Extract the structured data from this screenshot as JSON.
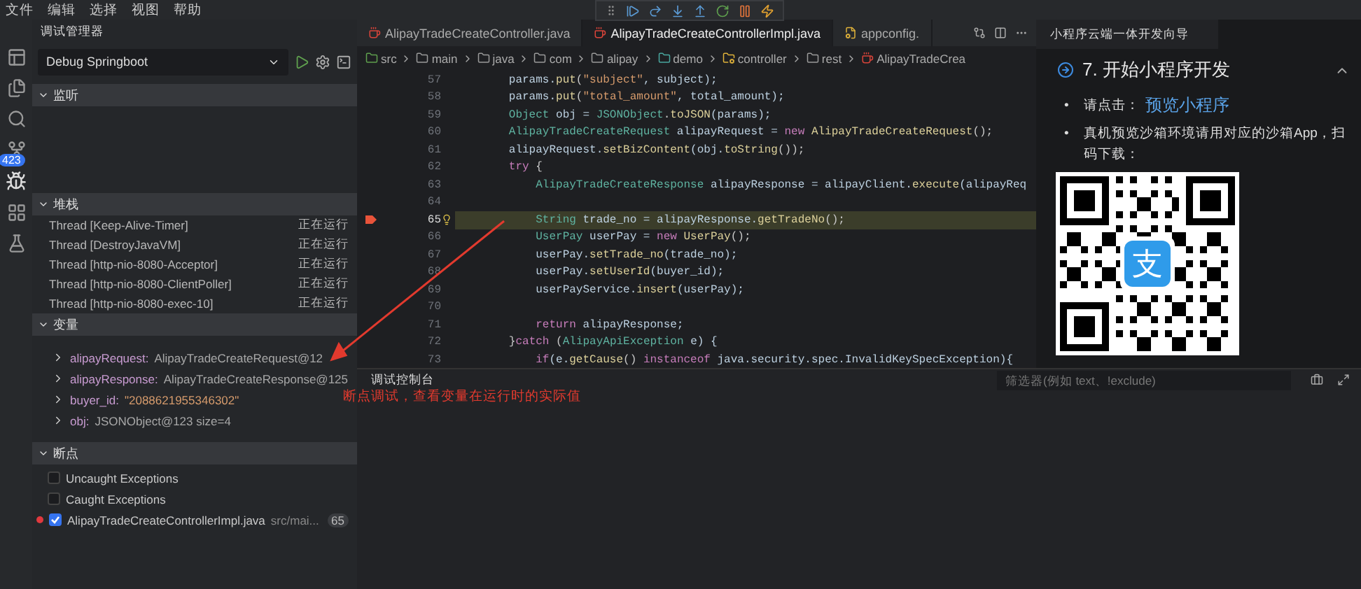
{
  "menu": [
    "文件",
    "编辑",
    "选择",
    "视图",
    "帮助"
  ],
  "activity_bar": {
    "source_control_badge": "423"
  },
  "sidebar": {
    "title": "调试管理器",
    "config": "Debug Springboot",
    "sections": [
      {
        "title": "监听",
        "kind": "watch",
        "expanded": true
      },
      {
        "title": "堆栈",
        "kind": "stack",
        "expanded": true
      },
      {
        "title": "变量",
        "kind": "variables",
        "expanded": true
      },
      {
        "title": "断点",
        "kind": "breakpoints",
        "expanded": true
      }
    ],
    "threads": [
      {
        "name": "Thread [Keep-Alive-Timer]",
        "status": "正在运行"
      },
      {
        "name": "Thread [DestroyJavaVM]",
        "status": "正在运行"
      },
      {
        "name": "Thread [http-nio-8080-Acceptor]",
        "status": "正在运行"
      },
      {
        "name": "Thread [http-nio-8080-ClientPoller]",
        "status": "正在运行"
      },
      {
        "name": "Thread [http-nio-8080-exec-10]",
        "status": "正在运行"
      }
    ],
    "variables": [
      {
        "name": "alipayRequest:",
        "value": "AlipayTradeCreateRequest@12",
        "kind": "object"
      },
      {
        "name": "alipayResponse:",
        "value": "AlipayTradeCreateResponse@125",
        "kind": "object"
      },
      {
        "name": "buyer_id:",
        "value": "\"2088621955346302\"",
        "kind": "string"
      },
      {
        "name": "obj:",
        "value": "JSONObject@123 size=4",
        "kind": "object"
      }
    ],
    "breakpoints": [
      {
        "label": "Uncaught Exceptions",
        "checked": false,
        "kind": "exception"
      },
      {
        "label": "Caught Exceptions",
        "checked": false,
        "kind": "exception"
      },
      {
        "label": "AlipayTradeCreateControllerImpl.java",
        "path": "src/mai...",
        "line": "65",
        "checked": true,
        "kind": "file"
      }
    ]
  },
  "editor": {
    "tabs": [
      {
        "label": "AlipayTradeCreateController.java",
        "kind": "java",
        "selected": false
      },
      {
        "label": "AlipayTradeCreateControllerImpl.java",
        "kind": "java",
        "selected": true
      },
      {
        "label": "appconfig.",
        "kind": "config",
        "selected": false
      }
    ],
    "breadcrumbs": [
      {
        "label": "src",
        "kind": "source"
      },
      {
        "label": "main",
        "kind": "folder"
      },
      {
        "label": "java",
        "kind": "folder"
      },
      {
        "label": "com",
        "kind": "folder"
      },
      {
        "label": "alipay",
        "kind": "folder"
      },
      {
        "label": "demo",
        "kind": "package"
      },
      {
        "label": "controller",
        "kind": "settings"
      },
      {
        "label": "rest",
        "kind": "folder"
      },
      {
        "label": "AlipayTradeCrea",
        "kind": "java"
      }
    ],
    "lines": [
      {
        "number": "57",
        "current": false,
        "tokens": [
          {
            "text": "        params.",
            "kind": "variable"
          },
          {
            "text": "put",
            "kind": "method"
          },
          {
            "text": "(",
            "kind": "plain"
          },
          {
            "text": "\"subject\"",
            "kind": "string"
          },
          {
            "text": ", subject);",
            "kind": "variable"
          }
        ]
      },
      {
        "number": "58",
        "current": false,
        "tokens": [
          {
            "text": "        params.",
            "kind": "variable"
          },
          {
            "text": "put",
            "kind": "method"
          },
          {
            "text": "(",
            "kind": "plain"
          },
          {
            "text": "\"total_amount\"",
            "kind": "string"
          },
          {
            "text": ", total_amount);",
            "kind": "variable"
          }
        ]
      },
      {
        "number": "59",
        "current": false,
        "tokens": [
          {
            "text": "        Object",
            "kind": "type"
          },
          {
            "text": " obj = ",
            "kind": "variable"
          },
          {
            "text": "JSONObject",
            "kind": "type"
          },
          {
            "text": ".",
            "kind": "plain"
          },
          {
            "text": "toJSON",
            "kind": "method"
          },
          {
            "text": "(params);",
            "kind": "variable"
          }
        ]
      },
      {
        "number": "60",
        "current": false,
        "tokens": [
          {
            "text": "        AlipayTradeCreateRequest",
            "kind": "type"
          },
          {
            "text": " alipayRequest = ",
            "kind": "variable"
          },
          {
            "text": "new",
            "kind": "keyword"
          },
          {
            "text": " AlipayTradeCreateRequest",
            "kind": "method"
          },
          {
            "text": "();",
            "kind": "plain"
          }
        ]
      },
      {
        "number": "61",
        "current": false,
        "tokens": [
          {
            "text": "        alipayRequest.",
            "kind": "variable"
          },
          {
            "text": "setBizContent",
            "kind": "method"
          },
          {
            "text": "(obj.",
            "kind": "variable"
          },
          {
            "text": "toString",
            "kind": "method"
          },
          {
            "text": "());",
            "kind": "plain"
          }
        ]
      },
      {
        "number": "62",
        "current": false,
        "tokens": [
          {
            "text": "        try",
            "kind": "keyword"
          },
          {
            "text": " {",
            "kind": "plain"
          }
        ]
      },
      {
        "number": "63",
        "current": false,
        "tokens": [
          {
            "text": "            AlipayTradeCreateResponse",
            "kind": "type"
          },
          {
            "text": " alipayResponse = alipayClient.",
            "kind": "variable"
          },
          {
            "text": "execute",
            "kind": "method"
          },
          {
            "text": "(alipayReq",
            "kind": "variable"
          }
        ]
      },
      {
        "number": "64",
        "current": false
      },
      {
        "number": "65",
        "current": true,
        "tokens": [
          {
            "text": "            String",
            "kind": "type"
          },
          {
            "text": " trade_no = alipayResponse.",
            "kind": "variable"
          },
          {
            "text": "getTradeNo",
            "kind": "method"
          },
          {
            "text": "();",
            "kind": "plain"
          }
        ]
      },
      {
        "number": "66",
        "current": false,
        "tokens": [
          {
            "text": "            UserPay",
            "kind": "type"
          },
          {
            "text": " userPay = ",
            "kind": "variable"
          },
          {
            "text": "new",
            "kind": "keyword"
          },
          {
            "text": " UserPay",
            "kind": "method"
          },
          {
            "text": "();",
            "kind": "plain"
          }
        ]
      },
      {
        "number": "67",
        "current": false,
        "tokens": [
          {
            "text": "            userPay.",
            "kind": "variable"
          },
          {
            "text": "setTrade_no",
            "kind": "method"
          },
          {
            "text": "(trade_no);",
            "kind": "variable"
          }
        ]
      },
      {
        "number": "68",
        "current": false,
        "tokens": [
          {
            "text": "            userPay.",
            "kind": "variable"
          },
          {
            "text": "setUserId",
            "kind": "method"
          },
          {
            "text": "(buyer_id);",
            "kind": "variable"
          }
        ]
      },
      {
        "number": "69",
        "current": false,
        "tokens": [
          {
            "text": "            userPayService.",
            "kind": "variable"
          },
          {
            "text": "insert",
            "kind": "method"
          },
          {
            "text": "(userPay);",
            "kind": "variable"
          }
        ]
      },
      {
        "number": "70",
        "current": false
      },
      {
        "number": "71",
        "current": false,
        "tokens": [
          {
            "text": "            return",
            "kind": "keyword"
          },
          {
            "text": " alipayResponse;",
            "kind": "variable"
          }
        ]
      },
      {
        "number": "72",
        "current": false,
        "tokens": [
          {
            "text": "        }",
            "kind": "plain"
          },
          {
            "text": "catch",
            "kind": "keyword"
          },
          {
            "text": " (",
            "kind": "plain"
          },
          {
            "text": "AlipayApiException",
            "kind": "type"
          },
          {
            "text": " e) {",
            "kind": "variable"
          }
        ]
      },
      {
        "number": "73",
        "current": false,
        "tokens": [
          {
            "text": "            if",
            "kind": "keyword"
          },
          {
            "text": "(e.",
            "kind": "variable"
          },
          {
            "text": "getCause",
            "kind": "method"
          },
          {
            "text": "() ",
            "kind": "plain"
          },
          {
            "text": "instanceof",
            "kind": "keyword"
          },
          {
            "text": " java.security.spec.InvalidKeySpecException){",
            "kind": "variable"
          }
        ]
      }
    ]
  },
  "guide": {
    "tab": "小程序云端一体开发向导",
    "step": "7. 开始小程序开发",
    "expanded": true,
    "bullets": [
      {
        "marker": "•",
        "text": "请点击：",
        "link": "预览小程序"
      },
      {
        "marker": "•",
        "text": "真机预览沙箱环境请用对应的沙箱App，扫码下载："
      }
    ],
    "qr_logo": "支"
  },
  "console": {
    "tab": "调试控制台",
    "filter_placeholder": "筛选器(例如 text、!exclude)"
  },
  "annotation": {
    "text": "断点调试，查看变量在运行时的实际值"
  }
}
